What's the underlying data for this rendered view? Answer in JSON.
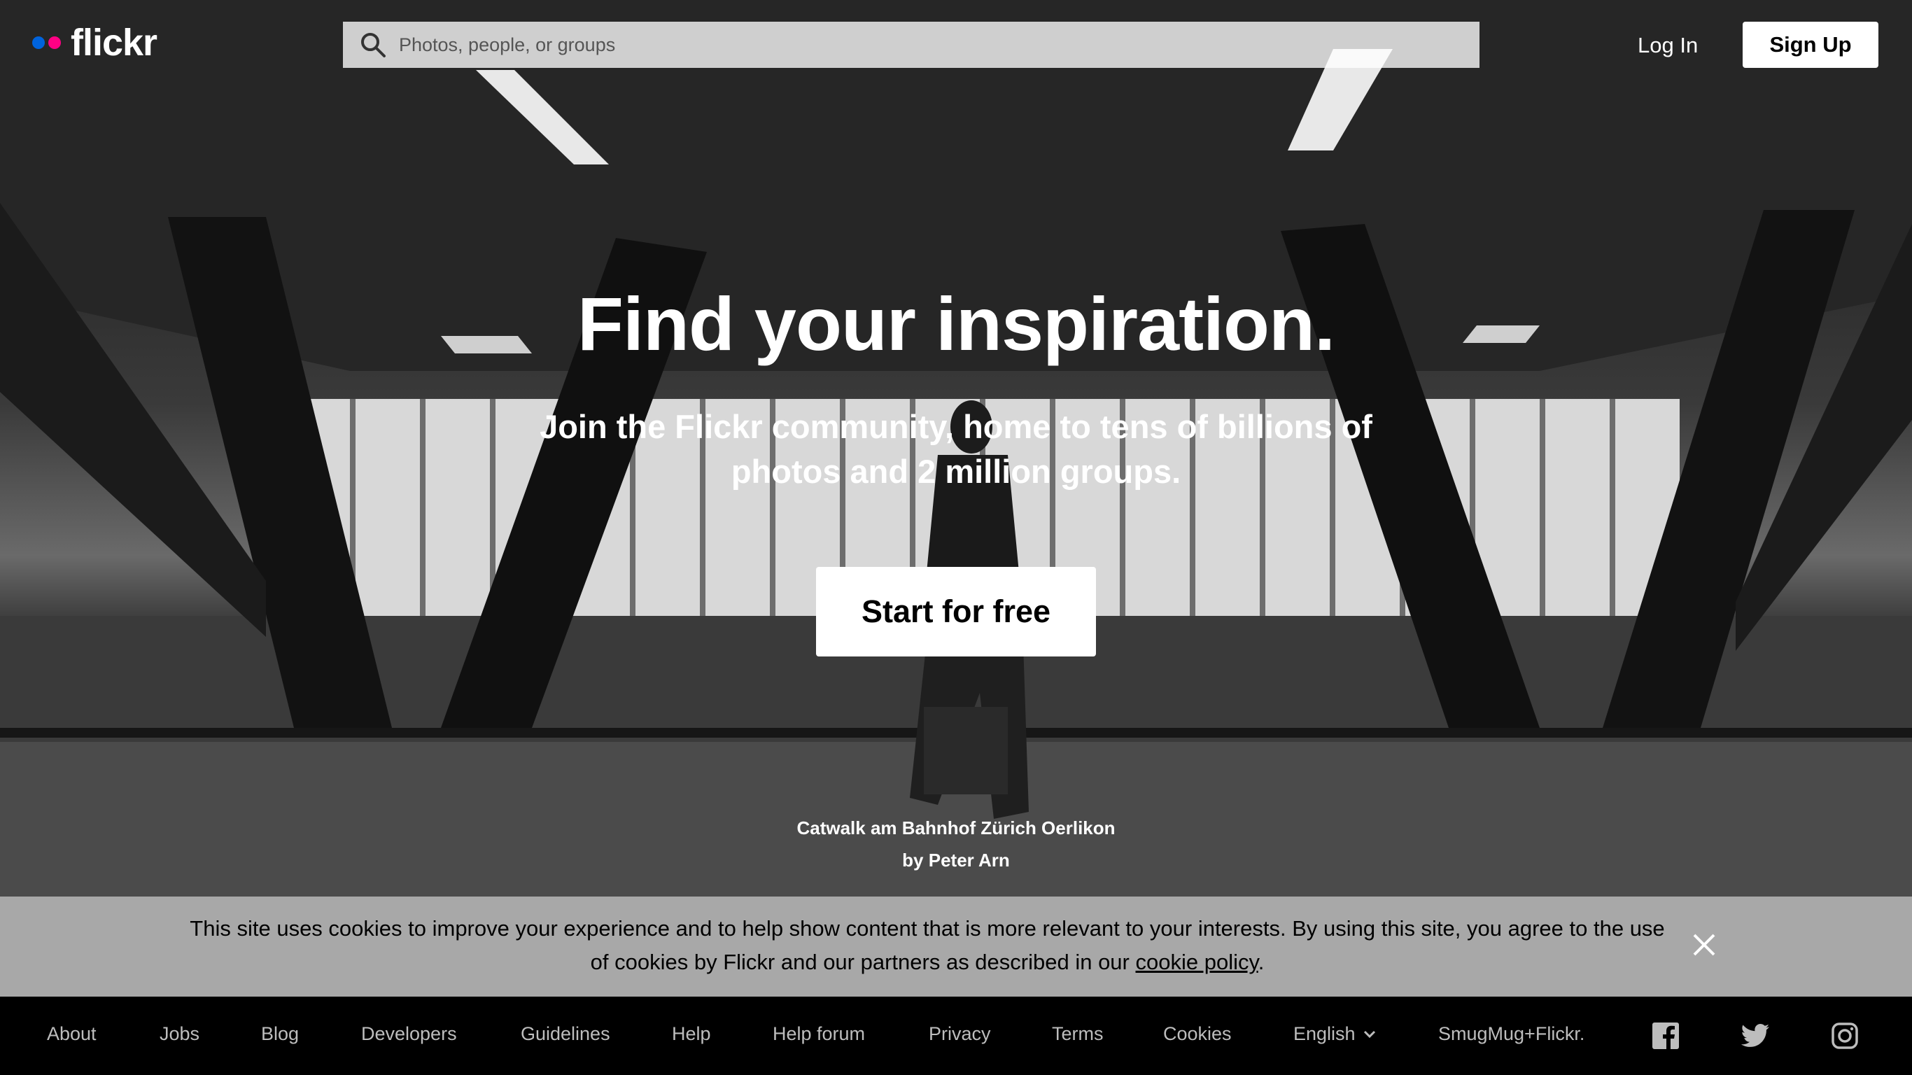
{
  "header": {
    "logo_text": "flickr",
    "search_placeholder": "Photos, people, or groups",
    "login_label": "Log In",
    "signup_label": "Sign Up"
  },
  "hero": {
    "headline": "Find your inspiration.",
    "subline": "Join the Flickr community, home to tens of billions of photos and 2 million groups.",
    "cta_label": "Start for free",
    "photo_title": "Catwalk am Bahnhof Zürich Oerlikon",
    "photo_author": "by Peter Arn"
  },
  "cookie_banner": {
    "text": "This site uses cookies to improve your experience and to help show content that is more relevant to your interests. By using this site, you agree to the use of cookies by Flickr and our partners as described in our ",
    "link_label": "cookie policy",
    "suffix": "."
  },
  "footer": {
    "links": [
      "About",
      "Jobs",
      "Blog",
      "Developers",
      "Guidelines",
      "Help",
      "Help forum",
      "Privacy",
      "Terms",
      "Cookies"
    ],
    "language": "English",
    "brand_link": "SmugMug+Flickr.",
    "social_icons": [
      "facebook-icon",
      "twitter-icon",
      "instagram-icon"
    ]
  },
  "colors": {
    "logo_blue": "#0063dc",
    "logo_pink": "#ff0084",
    "cookie_bg": "#a8a8a8",
    "footer_bg": "#000000",
    "footer_text": "#bdbdbd"
  }
}
